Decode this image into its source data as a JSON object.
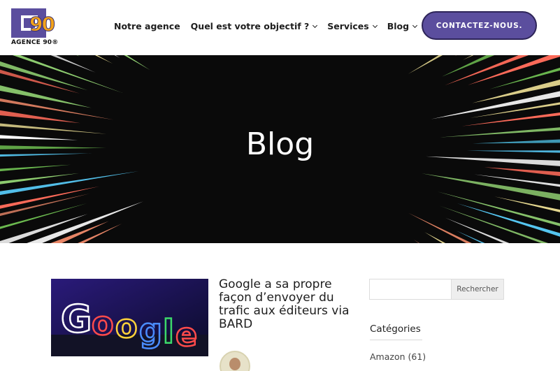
{
  "header": {
    "logo_number": "90",
    "logo_text": "AGENCE 90®",
    "nav": [
      {
        "label": "Notre agence",
        "has_dropdown": false
      },
      {
        "label": "Quel est votre objectif ?",
        "has_dropdown": true
      },
      {
        "label": "Services",
        "has_dropdown": true
      },
      {
        "label": "Blog",
        "has_dropdown": true
      }
    ],
    "cta_label": "CONTACTEZ-NOUS.",
    "brand_color": "#5b4e9e",
    "accent_color": "#f2a31b"
  },
  "hero": {
    "title": "Blog"
  },
  "post": {
    "title": "Google a sa propre façon d’envoyer du trafic aux éditeurs via BARD",
    "thumbnail_text": "Google"
  },
  "sidebar": {
    "search_placeholder": "",
    "search_button": "Rechercher",
    "categories_title": "Catégories",
    "categories": [
      {
        "label": "Amazon (61)"
      }
    ]
  }
}
